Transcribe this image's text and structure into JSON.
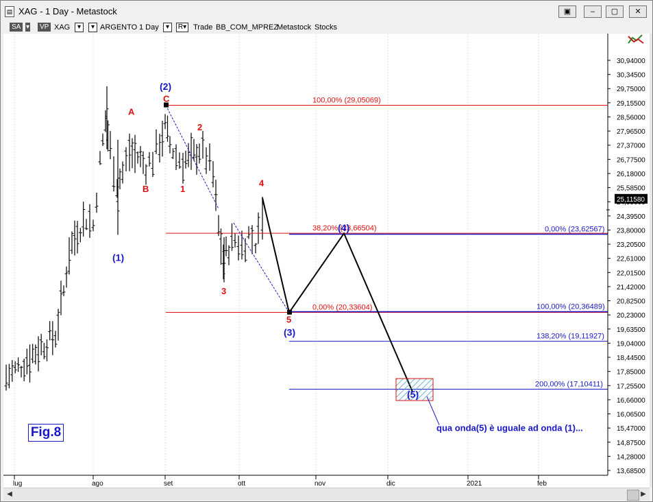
{
  "window": {
    "title": "XAG - 1 Day - Metastock",
    "buttons": [
      "▣",
      "‒",
      "▢",
      "✕"
    ]
  },
  "toolbar": {
    "sa_label": "SA",
    "vp_label": "VP",
    "symbol": "XAG",
    "name": "ARGENTO",
    "period": "1 Day",
    "r_label": "R",
    "trade_label": "Trade",
    "template": "BB_COM_MPREZ",
    "source": "Metastock",
    "type": "Stocks"
  },
  "chart_data": {
    "type": "candlestick",
    "title": "XAG - 1 Day - Metastock",
    "y_ticks": [
      "30,94000",
      "30,34500",
      "29,75000",
      "29,15500",
      "28,56000",
      "27,96500",
      "27,37000",
      "26,77500",
      "26,18000",
      "25,58500",
      "24,99000",
      "24,39500",
      "23,80000",
      "23,20500",
      "22,61000",
      "22,01500",
      "21,42000",
      "20,82500",
      "20,23000",
      "19,63500",
      "19,04000",
      "18,44500",
      "17,85000",
      "17,25500",
      "16,66000",
      "16,06500",
      "15,47000",
      "14,87500",
      "14,28000",
      "13,68500"
    ],
    "ylim": [
      13.4,
      31.6
    ],
    "x_ticks": [
      "lug",
      "ago",
      "set",
      "ott",
      "nov",
      "dic",
      "2021",
      "feb"
    ],
    "last_price": "25,11580",
    "fib_lines": [
      {
        "label": "100,00% (29,05069)",
        "value": 29.05069
      },
      {
        "label": "38,20% (23,66504)",
        "value": 23.66504
      },
      {
        "label": "0,00% (20,33604)",
        "value": 20.33604
      }
    ],
    "projection_lines": [
      {
        "label": "0,00% (23,62567)",
        "value": 23.62567
      },
      {
        "label": "100,00% (20,36489)",
        "value": 20.36489
      },
      {
        "label": "138,20% (19,11927)",
        "value": 19.11927
      },
      {
        "label": "200,00% (17,10411)",
        "value": 17.10411
      }
    ],
    "wave_labels_blue": [
      "(1)",
      "(2)",
      "(3)",
      "(4)",
      "(5)"
    ],
    "wave_labels_red": [
      "A",
      "B",
      "C",
      "1",
      "2",
      "3",
      "4",
      "5"
    ],
    "annotation": "qua onda(5) è uguale ad onda (1)...",
    "figure_label": "Fig.8"
  },
  "colors": {
    "red": "#e01010",
    "blue": "#1818c8",
    "black": "#000000"
  }
}
